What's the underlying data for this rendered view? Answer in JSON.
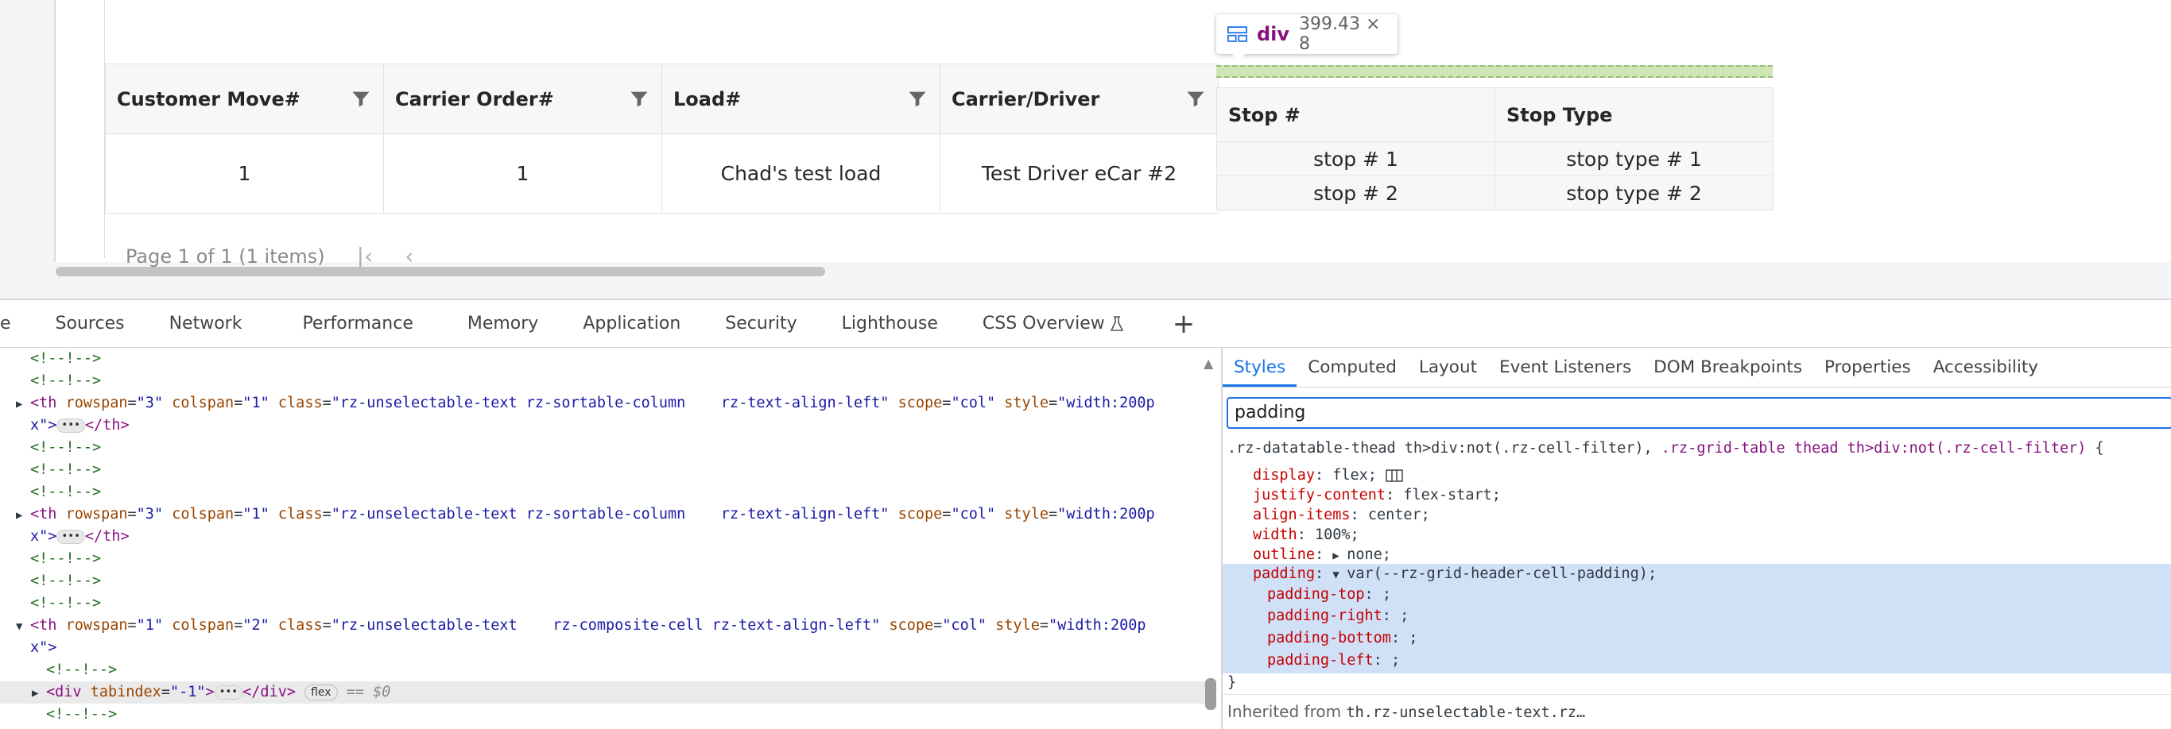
{
  "grid": {
    "columns": [
      "Customer Move#",
      "Carrier Order#",
      "Load#",
      "Carrier/Driver"
    ],
    "row": [
      "1",
      "1",
      "Chad's test load",
      "Test Driver eCar #2"
    ],
    "pager_text": "Page 1 of 1 (1 items)",
    "pager_first": "|‹",
    "pager_prev": "‹"
  },
  "stops": {
    "columns": [
      "Stop #",
      "Stop Type"
    ],
    "rows": [
      [
        "stop # 1",
        "stop type # 1"
      ],
      [
        "stop # 2",
        "stop type # 2"
      ]
    ]
  },
  "tooltip": {
    "tag": "div",
    "size": "399.43 × 8"
  },
  "devtools": {
    "tabs": [
      "e",
      "Sources",
      "Network",
      "Performance",
      "Memory",
      "Application",
      "Security",
      "Lighthouse",
      "CSS Overview"
    ],
    "plus": "+"
  },
  "elements": {
    "comment": "<!--!-->",
    "th1": {
      "open": "<th",
      "rowspan_attr": "rowspan",
      "rowspan_val": "\"3\"",
      "colspan_attr": "colspan",
      "colspan_val": "\"1\"",
      "class_attr": "class",
      "class_val": "\"rz-unselectable-text rz-sortable-column    rz-text-align-left\"",
      "scope_attr": "scope",
      "scope_val": "\"col\"",
      "style_attr": "style",
      "style_val": "\"width:200p",
      "cont": "x\">",
      "close": "</th>"
    },
    "th3": {
      "rowspan_val": "\"1\"",
      "colspan_val": "\"2\"",
      "class_val": "\"rz-unselectable-text    rz-composite-cell rz-text-align-left\""
    },
    "div_line": {
      "open": "<div",
      "attr": "tabindex",
      "val": "\"-1\"",
      "close": "</div>",
      "badge": "flex",
      "ref": "== $0"
    }
  },
  "styles": {
    "tabs": [
      "Styles",
      "Computed",
      "Layout",
      "Event Listeners",
      "DOM Breakpoints",
      "Properties",
      "Accessibility"
    ],
    "filter": "padding",
    "selector_a": ".rz-datatable-thead th>div:not(.rz-cell-filter), ",
    "selector_b": ".rz-grid-table thead th>div:not(.rz-cell-filter)",
    "brace_open": " {",
    "props": [
      {
        "name": "display",
        "value": "flex;"
      },
      {
        "name": "justify-content",
        "value": "flex-start;"
      },
      {
        "name": "align-items",
        "value": "center;"
      },
      {
        "name": "width",
        "value": "100%;"
      },
      {
        "name": "outline",
        "value": "none;"
      }
    ],
    "padding": {
      "name": "padding",
      "value": "var(--rz-grid-header-cell-padding);"
    },
    "sub": [
      {
        "name": "padding-top",
        "value": ";"
      },
      {
        "name": "padding-right",
        "value": ";"
      },
      {
        "name": "padding-bottom",
        "value": ";"
      },
      {
        "name": "padding-left",
        "value": ";"
      }
    ],
    "brace_close": "}",
    "inherited_label": "Inherited from ",
    "inherited_link": "th.rz-unselectable-text.rz…"
  },
  "colors": {
    "accent": "#1a73e8",
    "tag": "#881280",
    "attr_name": "#994500",
    "attr_value": "#1a1aa6",
    "comment": "#236e25",
    "prop_name": "#c80000"
  },
  "icons": {
    "filter": "funnel-icon",
    "tooltip": "grid-layout-icon",
    "flex": "flexbox-editor-icon",
    "beaker": "experimental-beaker-icon"
  }
}
